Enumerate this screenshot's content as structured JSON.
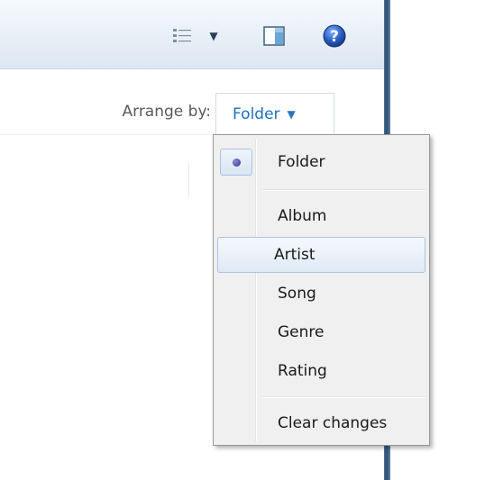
{
  "arrange": {
    "label": "Arrange by:",
    "current_value": "Folder",
    "caret": "▼"
  },
  "menu": {
    "items": [
      {
        "label": "Folder",
        "selected": true
      },
      {
        "label": "Album"
      },
      {
        "label": "Artist",
        "highlighted": true
      },
      {
        "label": "Song"
      },
      {
        "label": "Genre"
      },
      {
        "label": "Rating"
      },
      {
        "label": "Clear changes"
      }
    ]
  },
  "toolbar": {
    "views_icon": "details-view-icon",
    "views_caret": "▼",
    "preview_icon": "preview-pane-icon",
    "help_icon": "help-icon",
    "help_glyph": "?"
  }
}
